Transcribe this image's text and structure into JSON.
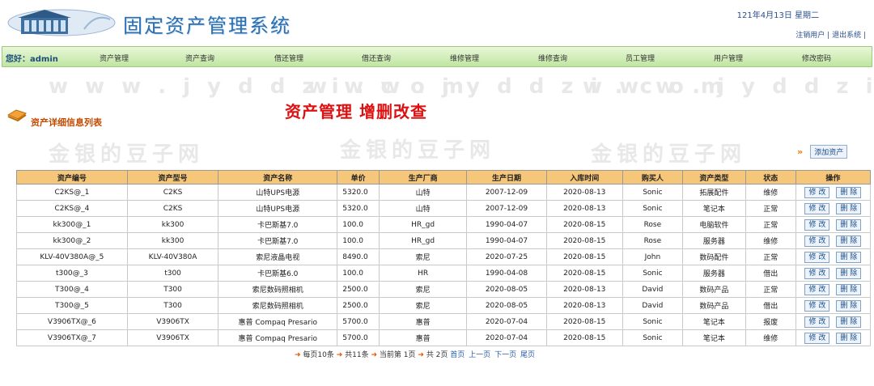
{
  "header": {
    "title": "固定资产管理系统",
    "date": "121年4月13日  星期二",
    "logout_user": "注销用户",
    "logout_system": "退出系统"
  },
  "nav": {
    "greeting": "您好：admin",
    "items": [
      "资产管理",
      "资产查询",
      "借还管理",
      "借还查询",
      "维修管理",
      "维修查询",
      "员工管理",
      "用户管理",
      "修改密码"
    ]
  },
  "watermark": {
    "site": "w w w . j y d d z i . c o m",
    "brand": "金银的豆子网"
  },
  "section": {
    "label": "资产详细信息列表",
    "heading": "资产管理  增删改查",
    "add_button": "添加资产"
  },
  "table": {
    "columns": [
      "资产编号",
      "资产型号",
      "资产名称",
      "单价",
      "生产厂商",
      "生产日期",
      "入库时间",
      "购买人",
      "资产类型",
      "状态",
      "操作"
    ],
    "edit_label": "修 改",
    "delete_label": "删 除",
    "rows": [
      [
        "C2KS@_1",
        "C2KS",
        "山特UPS电源",
        "5320.0",
        "山特",
        "2007-12-09",
        "2020-08-13",
        "Sonic",
        "拓展配件",
        "维修"
      ],
      [
        "C2KS@_4",
        "C2KS",
        "山特UPS电源",
        "5320.0",
        "山特",
        "2007-12-09",
        "2020-08-13",
        "Sonic",
        "笔记本",
        "正常"
      ],
      [
        "kk300@_1",
        "kk300",
        "卡巴斯基7.0",
        "100.0",
        "HR_gd",
        "1990-04-07",
        "2020-08-15",
        "Rose",
        "电脑软件",
        "正常"
      ],
      [
        "kk300@_2",
        "kk300",
        "卡巴斯基7.0",
        "100.0",
        "HR_gd",
        "1990-04-07",
        "2020-08-15",
        "Rose",
        "服务器",
        "维修"
      ],
      [
        "KLV-40V380A@_5",
        "KLV-40V380A",
        "索尼液晶电视",
        "8490.0",
        "索尼",
        "2020-07-25",
        "2020-08-15",
        "John",
        "数码配件",
        "正常"
      ],
      [
        "t300@_3",
        "t300",
        "卡巴斯基6.0",
        "100.0",
        "HR",
        "1990-04-08",
        "2020-08-15",
        "Sonic",
        "服务器",
        "借出"
      ],
      [
        "T300@_4",
        "T300",
        "索尼数码照相机",
        "2500.0",
        "索尼",
        "2020-08-05",
        "2020-08-13",
        "David",
        "数码产品",
        "正常"
      ],
      [
        "T300@_5",
        "T300",
        "索尼数码照相机",
        "2500.0",
        "索尼",
        "2020-08-05",
        "2020-08-13",
        "David",
        "数码产品",
        "借出"
      ],
      [
        "V3906TX@_6",
        "V3906TX",
        "惠普 Compaq Presario",
        "5700.0",
        "惠普",
        "2020-07-04",
        "2020-08-15",
        "Sonic",
        "笔记本",
        "报废"
      ],
      [
        "V3906TX@_7",
        "V3906TX",
        "惠普 Compaq Presario",
        "5700.0",
        "惠普",
        "2020-07-04",
        "2020-08-15",
        "Sonic",
        "笔记本",
        "维修"
      ]
    ]
  },
  "pager": {
    "per_page": "每页10条",
    "total": "共11条",
    "current": "当前第 1页",
    "pages": "共 2页",
    "links": [
      "首页",
      "上一页",
      "下一页",
      "尾页"
    ]
  }
}
